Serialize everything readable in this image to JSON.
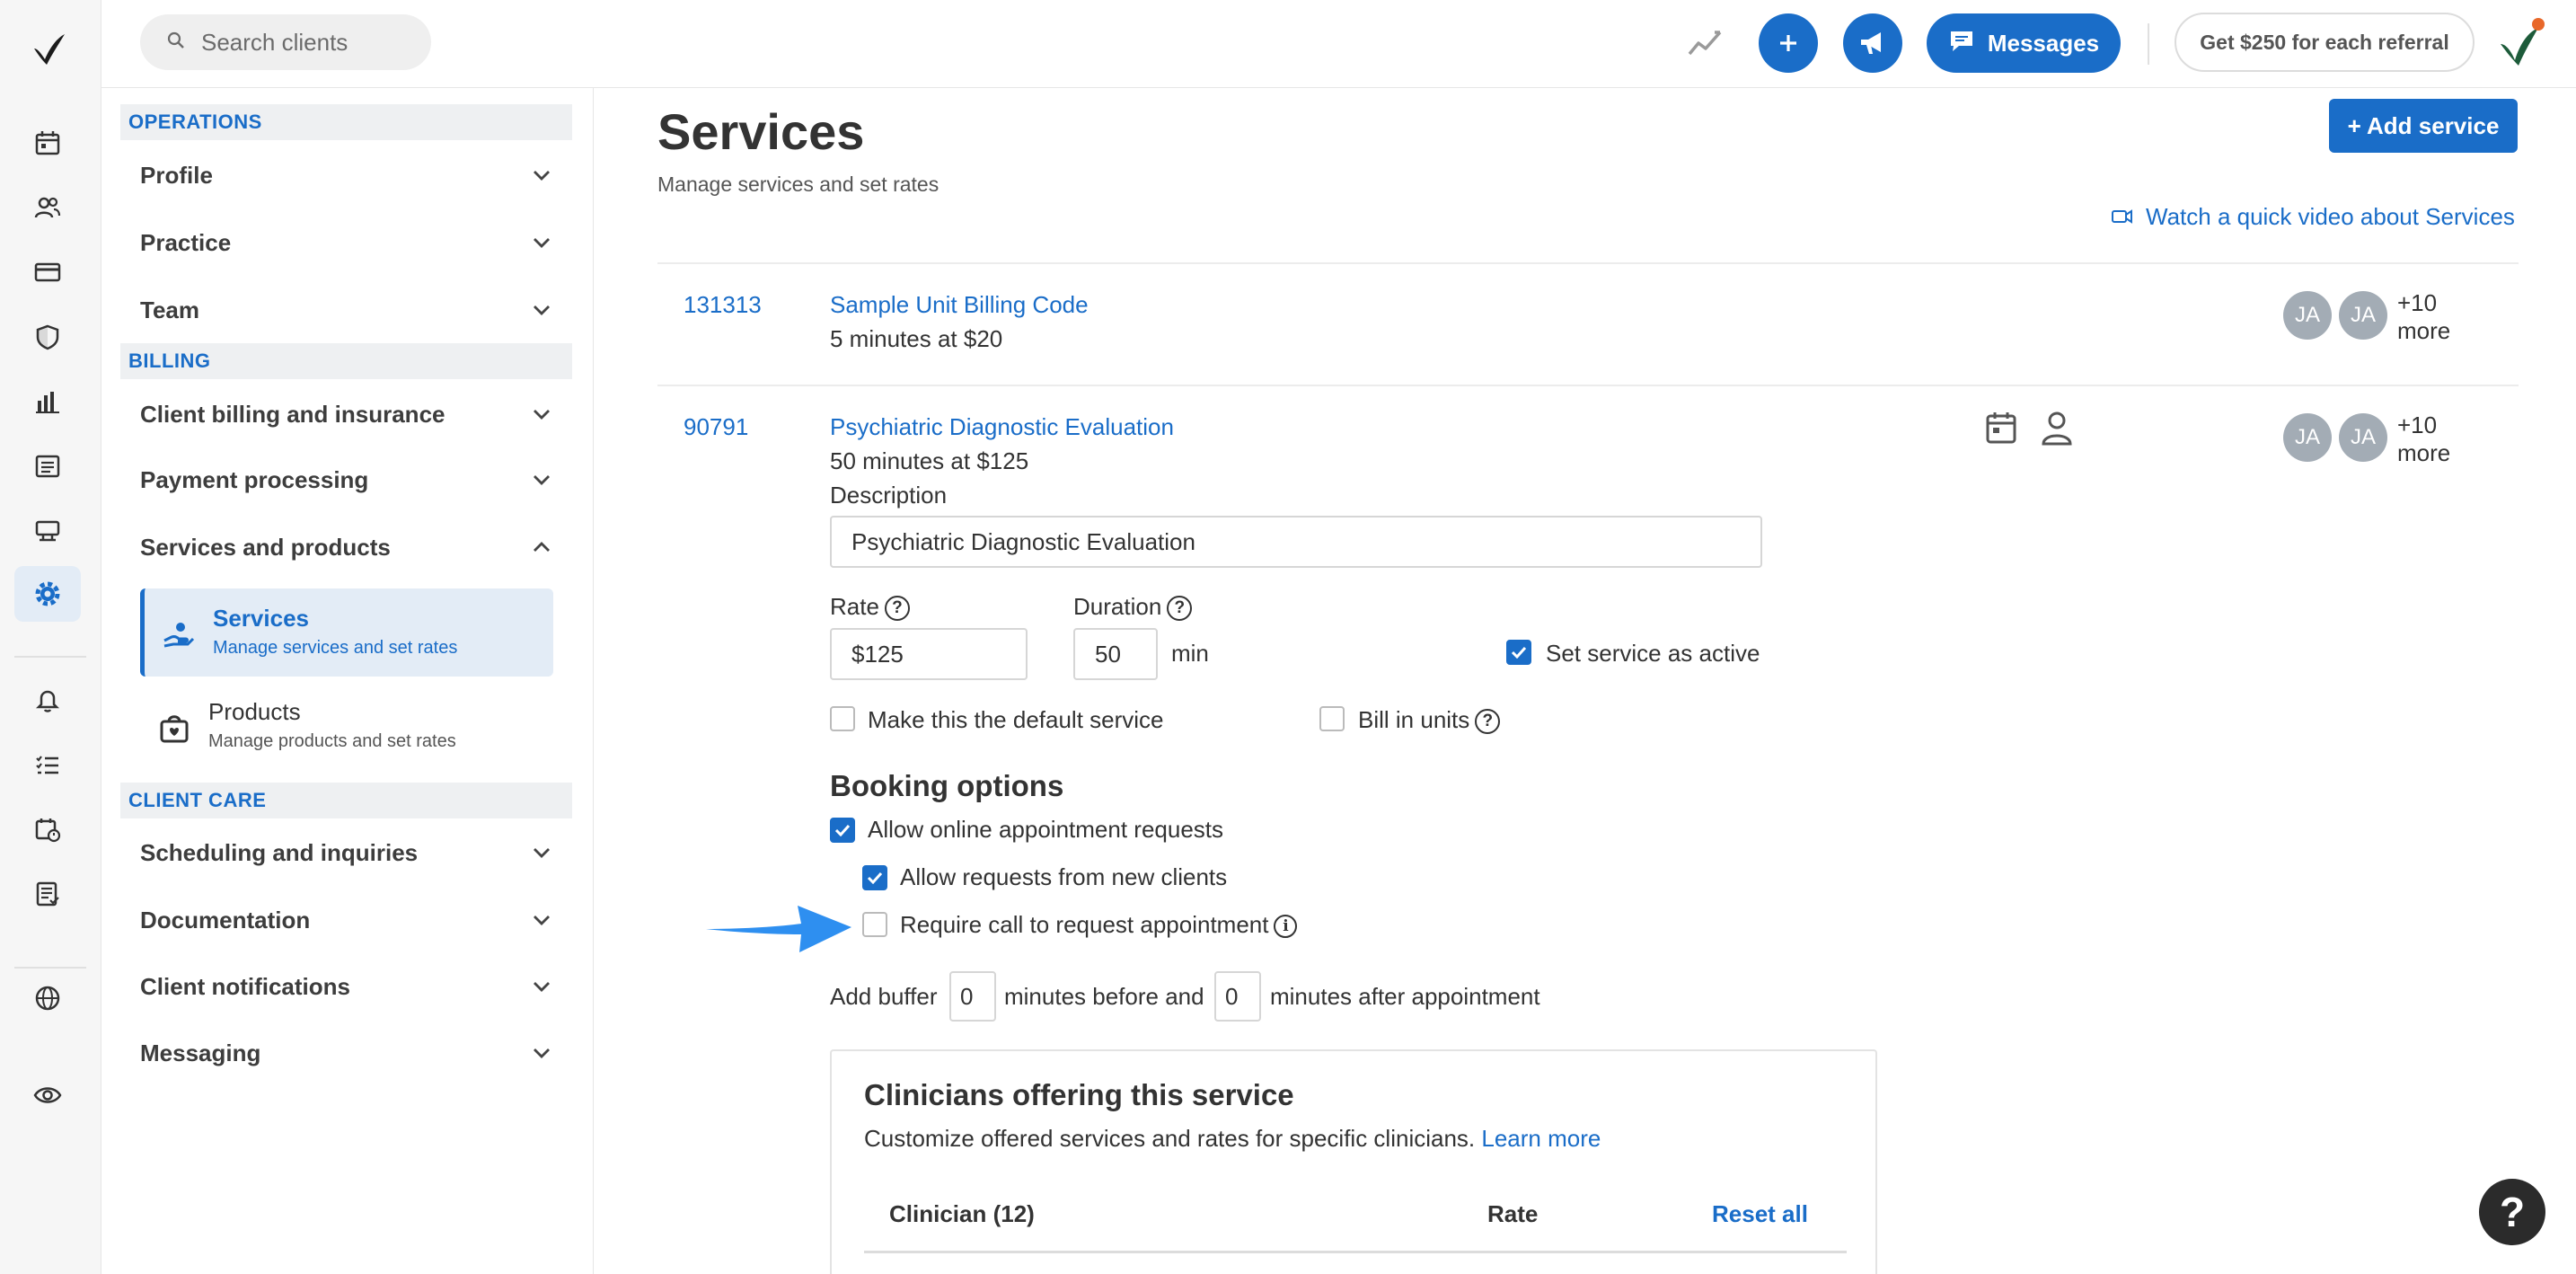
{
  "topbar": {
    "search_placeholder": "Search clients",
    "messages_label": "Messages",
    "referral_label": "Get $250 for each referral"
  },
  "settings_nav": {
    "sections": [
      {
        "heading": "OPERATIONS",
        "items": [
          "Profile",
          "Practice",
          "Team"
        ]
      },
      {
        "heading": "BILLING",
        "items": [
          "Client billing and insurance",
          "Payment processing",
          "Services and products"
        ]
      },
      {
        "heading": "CLIENT CARE",
        "items": [
          "Scheduling and inquiries",
          "Documentation",
          "Client notifications",
          "Messaging"
        ]
      }
    ],
    "sub_items": [
      {
        "title": "Services",
        "subtitle": "Manage services and set rates",
        "active": true
      },
      {
        "title": "Products",
        "subtitle": "Manage products and set rates",
        "active": false
      }
    ]
  },
  "page": {
    "title": "Services",
    "subtitle": "Manage services and set rates",
    "add_button": "+ Add service",
    "video_link": "Watch a quick video about Services"
  },
  "services": [
    {
      "code": "131313",
      "name": "Sample Unit Billing Code",
      "detail": "5 minutes at $20",
      "chips": [
        "JA",
        "JA"
      ],
      "more_line1": "+10",
      "more_line2": "more"
    },
    {
      "code": "90791",
      "name": "Psychiatric Diagnostic Evaluation",
      "detail": "50 minutes at $125",
      "chips": [
        "JA",
        "JA"
      ],
      "more_line1": "+10",
      "more_line2": "more"
    }
  ],
  "editor": {
    "description_label": "Description",
    "description_value": "Psychiatric Diagnostic Evaluation",
    "rate_label": "Rate",
    "rate_value": "$125",
    "duration_label": "Duration",
    "duration_value": "50",
    "duration_unit": "min",
    "active_label": "Set service as active",
    "active_checked": true,
    "default_label": "Make this the default service",
    "default_checked": false,
    "units_label": "Bill in units",
    "units_checked": false
  },
  "booking": {
    "heading": "Booking options",
    "allow_online_label": "Allow online appointment requests",
    "allow_online_checked": true,
    "allow_new_label": "Allow requests from new clients",
    "allow_new_checked": true,
    "require_call_label": "Require call to request appointment",
    "require_call_checked": false,
    "buffer_prefix": "Add buffer",
    "buffer_before": "0",
    "buffer_middle": "minutes before and",
    "buffer_after": "0",
    "buffer_suffix": "minutes after appointment"
  },
  "clinicians": {
    "title": "Clinicians offering this service",
    "subtitle": "Customize offered services and rates for specific clinicians.",
    "learn_more": "Learn more",
    "col_clinician": "Clinician (12)",
    "col_rate": "Rate",
    "reset_all": "Reset all"
  },
  "help_label": "?",
  "colors": {
    "brand": "#1a6dc8",
    "arrow": "#2e8ff0"
  }
}
